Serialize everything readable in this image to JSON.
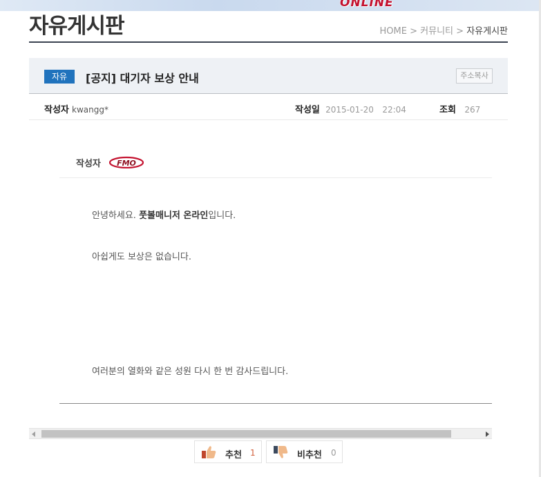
{
  "banner": {
    "logo_text": "ONLINE"
  },
  "page": {
    "title": "자유게시판"
  },
  "breadcrumb": {
    "home": "HOME",
    "sep1": ">",
    "section": "커뮤니티",
    "sep2": ">",
    "current": "자유게시판"
  },
  "post": {
    "category": "자유",
    "title": "[공지] 대기자 보상 안내",
    "copy_button": "주소복사",
    "author_label": "작성자",
    "author_value": "kwangg*",
    "date_label": "작성일",
    "date_value": "2015-01-20",
    "time_value": "22:04",
    "views_label": "조회",
    "views_value": "267"
  },
  "content": {
    "author_label": "작성자",
    "author_logo_text": "FMO",
    "p1_prefix": "안녕하세요. ",
    "p1_bold": "풋볼매니저 온라인",
    "p1_suffix": "입니다.",
    "p2": "아쉽게도 보상은 없습니다.",
    "p3": "여러분의 열화와 같은 성원 다시 한 번 감사드립니다."
  },
  "votes": {
    "up_label": "추천",
    "up_count": "1",
    "down_label": "비추천",
    "down_count": "0"
  },
  "colors": {
    "badge": "#2073bd",
    "header_bg": "#eef1f5",
    "rule": "#3a4250",
    "upvote_count": "#d15e3a"
  }
}
